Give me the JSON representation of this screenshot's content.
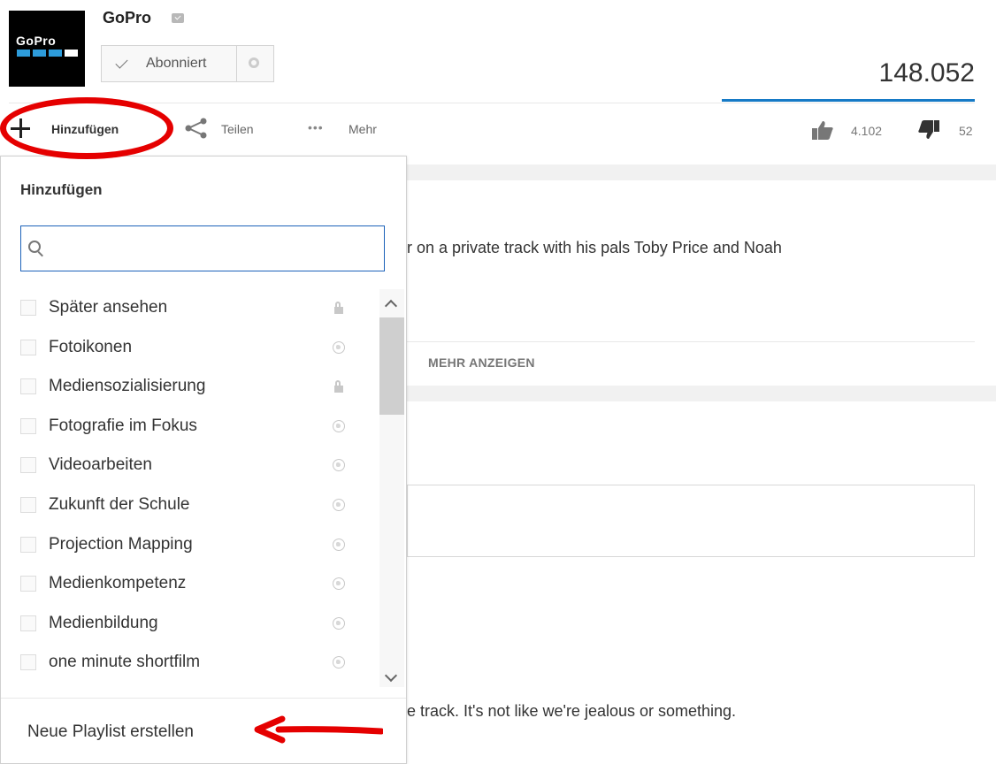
{
  "channel": {
    "name": "GoPro",
    "logo_text": "GoPro",
    "subscribe_label": "Abonniert"
  },
  "video": {
    "view_count": "148.052",
    "likes": "4.102",
    "dislikes": "52"
  },
  "actions": {
    "add_label": "Hinzufügen",
    "share_label": "Teilen",
    "more_label": "Mehr",
    "more_dots": "•••"
  },
  "description": {
    "text_fragment": "r on a private track with his pals Toby Price and Noah",
    "show_more": "MEHR ANZEIGEN"
  },
  "comment": {
    "text_fragment": "e track. It's not like we're jealous or something."
  },
  "dropdown": {
    "title": "Hinzufügen",
    "search_value": "",
    "playlists": [
      {
        "name": "Später ansehen",
        "privacy": "lock-icon"
      },
      {
        "name": "Fotoikonen",
        "privacy": "globe-icon"
      },
      {
        "name": "Mediensozialisierung",
        "privacy": "lock-icon"
      },
      {
        "name": "Fotografie im Fokus",
        "privacy": "globe-icon"
      },
      {
        "name": "Videoarbeiten",
        "privacy": "globe-icon"
      },
      {
        "name": "Zukunft der Schule",
        "privacy": "globe-icon"
      },
      {
        "name": "Projection Mapping",
        "privacy": "globe-icon"
      },
      {
        "name": "Medienkompetenz",
        "privacy": "globe-icon"
      },
      {
        "name": "Medienbildung",
        "privacy": "globe-icon"
      },
      {
        "name": "one minute shortfilm",
        "privacy": "globe-icon"
      }
    ],
    "new_playlist_label": "Neue Playlist erstellen"
  },
  "colors": {
    "accent_blue": "#167ac6",
    "annotation_red": "#e50000"
  }
}
